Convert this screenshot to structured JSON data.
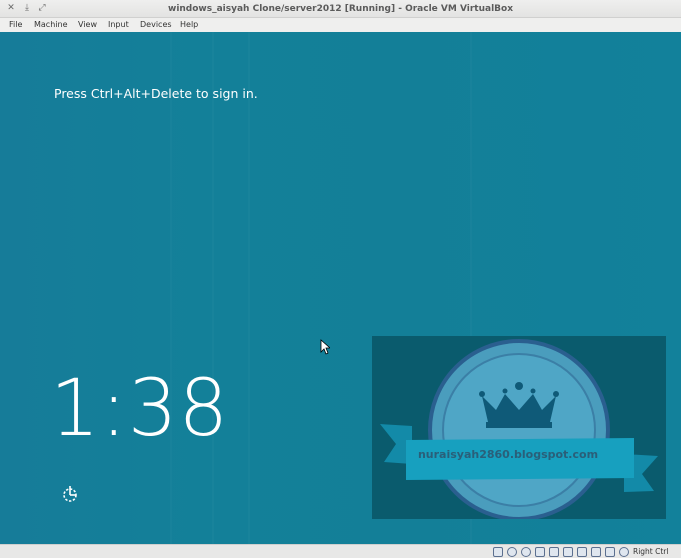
{
  "window": {
    "title": "windows_aisyah Clone/server2012 [Running] - Oracle VM VirtualBox",
    "controls": [
      "close-icon",
      "minimize-icon",
      "maximize-icon"
    ]
  },
  "menu": {
    "items": [
      "File",
      "Machine",
      "View",
      "Input",
      "Devices",
      "Help"
    ]
  },
  "vm": {
    "prompt": "Press Ctrl+Alt+Delete to sign in.",
    "time": "1:38",
    "background_color": "#137f98",
    "accessibility_icon": "ease-of-access-icon"
  },
  "watermark": {
    "text": "nuraisyah2860.blogspot.com"
  },
  "statusbar": {
    "icons": [
      "hard-disk-icon",
      "optical-drive-icon",
      "audio-icon",
      "network-icon",
      "usb-icon",
      "shared-folders-icon",
      "display-icon",
      "video-capture-icon",
      "virtualization-icon",
      "mouse-integration-icon",
      "keyboard-icon"
    ],
    "host_key": "Right Ctrl"
  }
}
